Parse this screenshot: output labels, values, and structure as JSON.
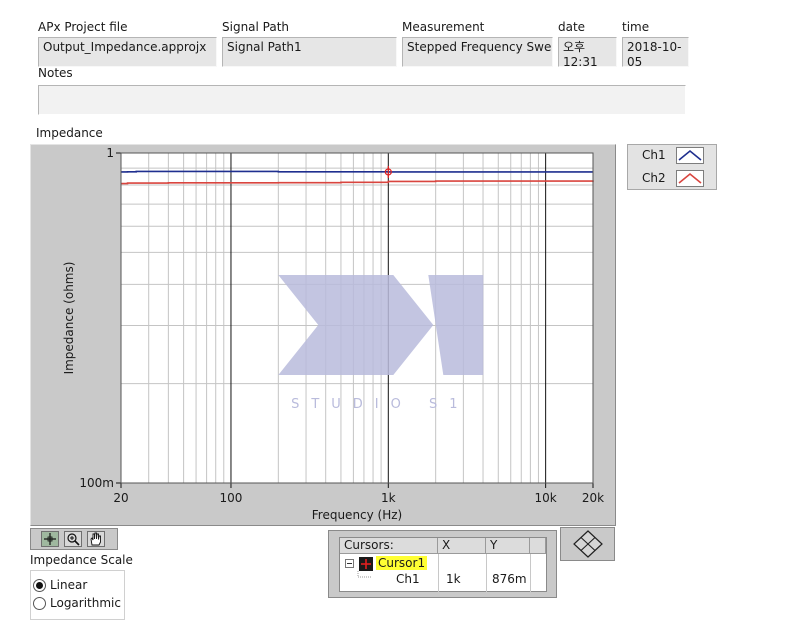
{
  "header": {
    "project_label": "APx Project file",
    "project_value": "Output_Impedance.approjx",
    "signal_path_label": "Signal Path",
    "signal_path_value": "Signal Path1",
    "measurement_label": "Measurement",
    "measurement_value": "Stepped Frequency Sweep",
    "date_label": "date",
    "date_value": "오후 12:31",
    "time_label": "time",
    "time_value": "2018-10-05",
    "notes_label": "Notes",
    "notes_value": ""
  },
  "graph_label": "Impedance",
  "watermark_text": "STUDIO S1",
  "chart_data": {
    "type": "line",
    "xlabel": "Frequency (Hz)",
    "ylabel": "Impedance (ohms)",
    "x_scale": "log",
    "y_scale": "log",
    "xlim": [
      20,
      20000
    ],
    "ylim": [
      0.1,
      1
    ],
    "x_ticks": [
      20,
      100,
      1000,
      10000,
      20000
    ],
    "x_tick_labels": [
      "20",
      "100",
      "1k",
      "10k",
      "20k"
    ],
    "y_ticks": [
      0.1,
      1
    ],
    "y_tick_labels": [
      "100m",
      "1"
    ],
    "grid": true,
    "legend_position": "outside-top-right",
    "series": [
      {
        "name": "Ch1",
        "color": "#1f2f8f",
        "x": [
          20,
          22,
          25,
          30,
          40,
          60,
          100,
          200,
          500,
          1000,
          2000,
          5000,
          10000,
          20000
        ],
        "y": [
          0.876,
          0.877,
          0.879,
          0.879,
          0.879,
          0.879,
          0.879,
          0.877,
          0.877,
          0.876,
          0.876,
          0.876,
          0.876,
          0.876
        ]
      },
      {
        "name": "Ch2",
        "color": "#d9453f",
        "x": [
          20,
          22,
          25,
          30,
          40,
          60,
          100,
          200,
          500,
          1000,
          2000,
          5000,
          10000,
          15000,
          20000
        ],
        "y": [
          0.808,
          0.811,
          0.811,
          0.811,
          0.812,
          0.812,
          0.812,
          0.813,
          0.815,
          0.82,
          0.822,
          0.822,
          0.822,
          0.822,
          0.816
        ]
      }
    ],
    "cursor": {
      "x": 1000,
      "y": 0.876,
      "color": "#e02020"
    }
  },
  "palette": {
    "frame": "#c9c9c9",
    "plot_bg": "#ffffff",
    "minor_grid": "#c4c4c4",
    "major_grid": "#111111",
    "watermark": "#b9bbdc",
    "highlight": "#ffff33"
  },
  "icons": {
    "cursor_tool": "crosshair-icon",
    "zoom_tool": "zoom-icon",
    "pan_tool": "hand-icon",
    "nav": "diamond-nav-icon",
    "cursor_marker": "cursor-marker-icon",
    "collapse": "minus-box-icon"
  },
  "scale": {
    "label": "Impedance Scale",
    "options": [
      {
        "label": "Linear",
        "selected": true
      },
      {
        "label": "Logarithmic",
        "selected": false
      }
    ]
  },
  "cursors": {
    "headers": [
      "Cursors:",
      "X",
      "Y"
    ],
    "cursor_name": "Cursor1",
    "rows": [
      {
        "channel": "Ch1",
        "x": "1k",
        "y": "876m"
      }
    ]
  }
}
